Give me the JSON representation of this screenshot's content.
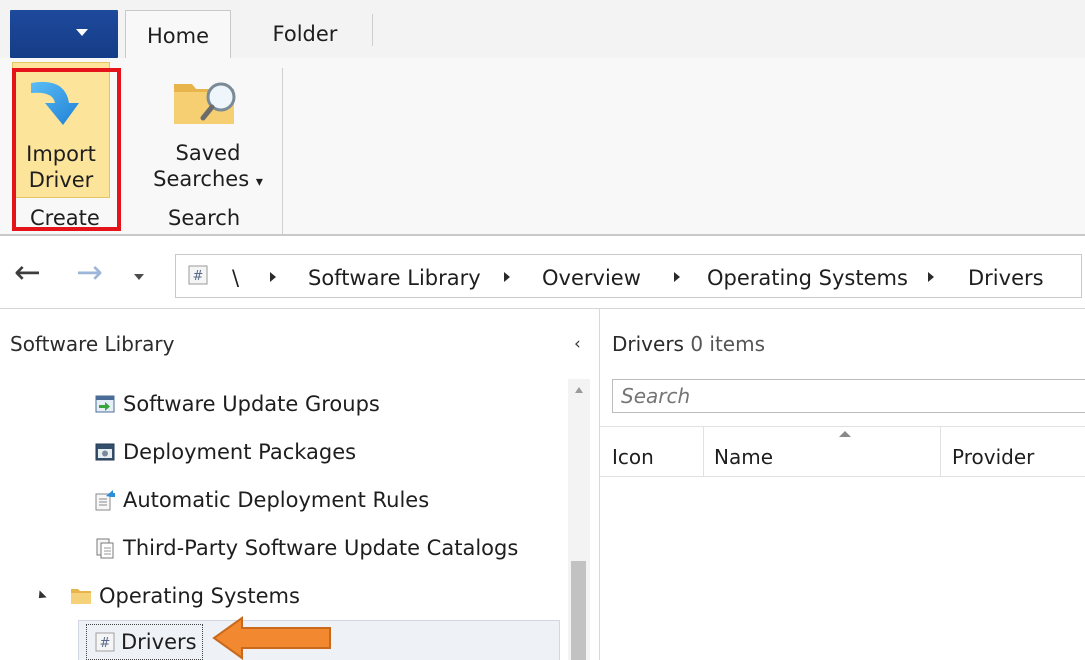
{
  "ribbon_tabs": {
    "home": "Home",
    "folder": "Folder"
  },
  "ribbon": {
    "import_driver_line1": "Import",
    "import_driver_line2": "Driver",
    "saved_searches_line1": "Saved",
    "saved_searches_line2": "Searches",
    "saved_searches_dropdown": "▾",
    "group_create": "Create",
    "group_search": "Search"
  },
  "address_bar": {
    "back": "←",
    "forward": "→",
    "root": "\\",
    "path": [
      "Software Library",
      "Overview",
      "Operating Systems",
      "Drivers"
    ]
  },
  "nav_pane": {
    "title": "Software Library",
    "collapse": "‹",
    "items": [
      {
        "label": "Software Update Groups",
        "icon": "software-update-groups-icon"
      },
      {
        "label": "Deployment Packages",
        "icon": "deployment-packages-icon"
      },
      {
        "label": "Automatic Deployment Rules",
        "icon": "automatic-deployment-rules-icon"
      },
      {
        "label": "Third-Party Software Update Catalogs",
        "icon": "catalog-icon"
      },
      {
        "label": "Operating Systems",
        "icon": "folder-icon",
        "expanded": true
      },
      {
        "label": "Drivers",
        "icon": "drivers-icon",
        "selected": true
      }
    ]
  },
  "content": {
    "title_prefix": "Drivers",
    "title_count": "0 items",
    "search_placeholder": "Search",
    "columns": [
      "Icon",
      "Name",
      "Provider"
    ]
  },
  "colors": {
    "app_menu": "#1e4a9c",
    "import_highlight": "#fce49a",
    "callout_border": "#e5141b",
    "callout_arrow": "#f2882f",
    "selection": "#eef1f6"
  }
}
